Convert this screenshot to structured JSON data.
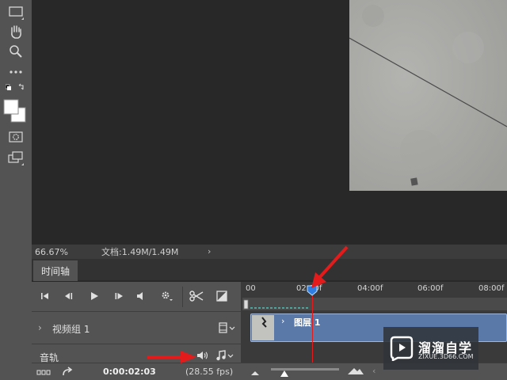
{
  "status_bar": {
    "zoom": "66.67%",
    "doc_info": "文档:1.49M/1.49M",
    "arrow": "›"
  },
  "timeline": {
    "tab_label": "时间轴",
    "ruler_ticks": [
      "00",
      "02:00f",
      "04:00f",
      "06:00f",
      "08:00f"
    ],
    "video_group_label": "视频组 1",
    "video_group_chevron": "›",
    "audio_track_label": "音轨",
    "clip_label": "图层 1",
    "timecode": "0:00:02:03",
    "fps": "(28.55 fps)"
  },
  "watermark": {
    "title": "溜溜自学",
    "url": "ZIXUE.3D66.COM"
  },
  "colors": {
    "accent_red": "#e31b1b",
    "clip_blue": "#5a78a8",
    "playhead_blue": "#2f7de1"
  },
  "icons": [
    "marquee-icon",
    "hand-icon",
    "zoom-icon",
    "more-icon",
    "swap-colors-icon",
    "color-swatch-icon",
    "quick-mask-icon",
    "screen-mode-icon",
    "go-to-first-frame-icon",
    "previous-frame-icon",
    "play-icon",
    "next-frame-icon",
    "mute-icon",
    "settings-gear-icon",
    "split-scissors-icon",
    "transition-icon",
    "film-strip-icon",
    "audio-volume-icon",
    "music-note-icon",
    "render-video-icon",
    "convert-arrow-icon"
  ]
}
